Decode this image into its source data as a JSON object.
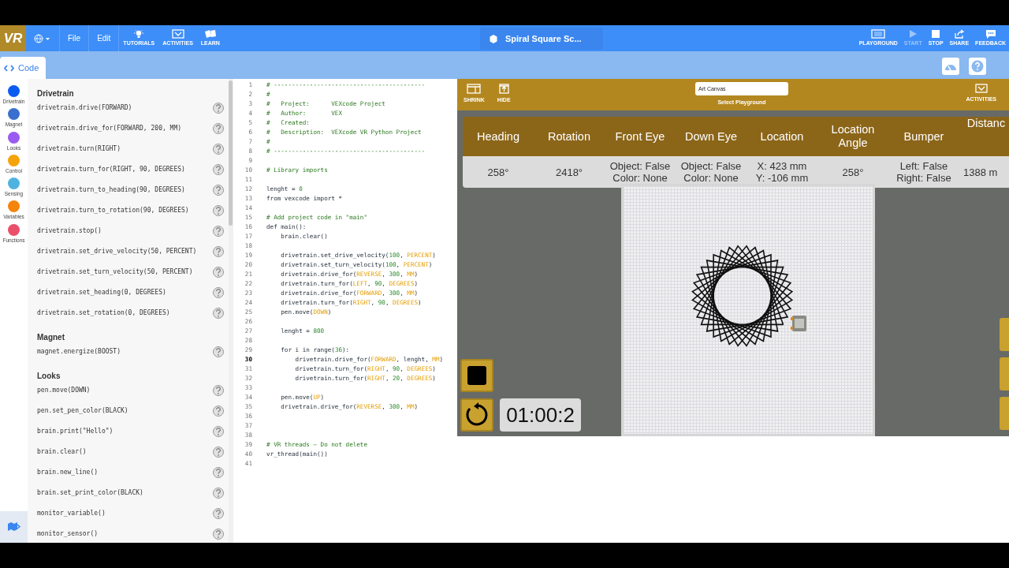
{
  "app_bar": {
    "logo": "VR",
    "menus": [
      {
        "label": "File"
      },
      {
        "label": "Edit"
      }
    ],
    "tools": [
      {
        "label": "TUTORIALS",
        "kind": "bulb"
      },
      {
        "label": "ACTIVITIES",
        "kind": "check"
      },
      {
        "label": "LEARN",
        "kind": "book"
      }
    ],
    "project_title": "Spiral Square Sc...",
    "actions": [
      {
        "label": "PLAYGROUND",
        "kind": "playground",
        "disabled": false
      },
      {
        "label": "START",
        "kind": "play",
        "disabled": true
      },
      {
        "label": "STOP",
        "kind": "stop",
        "disabled": false
      },
      {
        "label": "SHARE",
        "kind": "share",
        "disabled": false
      },
      {
        "label": "FEEDBACK",
        "kind": "feedback",
        "disabled": false
      }
    ]
  },
  "tabs": [
    {
      "label": "Code",
      "selected": true
    }
  ],
  "categories": [
    {
      "label": "Drivetrain",
      "color": "#0b5cf0"
    },
    {
      "label": "Magnet",
      "color": "#3a6fd0"
    },
    {
      "label": "Looks",
      "color": "#9a5cf0"
    },
    {
      "label": "Control",
      "color": "#f5a30a"
    },
    {
      "label": "Sensing",
      "color": "#4fb3e0"
    },
    {
      "label": "Variables",
      "color": "#f5840c"
    },
    {
      "label": "Functions",
      "color": "#ea4f6c"
    }
  ],
  "palette": [
    {
      "title": "Drivetrain",
      "blocks": [
        "drivetrain.drive(FORWARD)",
        "drivetrain.drive_for(FORWARD, 200, MM)",
        "drivetrain.turn(RIGHT)",
        "drivetrain.turn_for(RIGHT, 90, DEGREES)",
        "drivetrain.turn_to_heading(90, DEGREES)",
        "drivetrain.turn_to_rotation(90, DEGREES)",
        "drivetrain.stop()",
        "drivetrain.set_drive_velocity(50, PERCENT)",
        "drivetrain.set_turn_velocity(50, PERCENT)",
        "drivetrain.set_heading(0, DEGREES)",
        "drivetrain.set_rotation(0, DEGREES)"
      ]
    },
    {
      "title": "Magnet",
      "blocks": [
        "magnet.energize(BOOST)"
      ]
    },
    {
      "title": "Looks",
      "blocks": [
        "pen.move(DOWN)",
        "pen.set_pen_color(BLACK)",
        "brain.print(\"Hello\")",
        "brain.clear()",
        "brain.new_line()",
        "brain.set_print_color(BLACK)",
        "monitor_variable()",
        "monitor_sensor()"
      ]
    }
  ],
  "editor": {
    "lines": [
      {
        "n": "1",
        "current": false,
        "segs": [
          {
            "text": "# ------------------------------------------",
            "kind": "comment"
          }
        ]
      },
      {
        "n": "2",
        "current": false,
        "segs": [
          {
            "text": "#",
            "kind": "comment"
          }
        ]
      },
      {
        "n": "3",
        "current": false,
        "segs": [
          {
            "text": "#   Project:      VEXcode Project",
            "kind": "comment"
          }
        ]
      },
      {
        "n": "4",
        "current": false,
        "segs": [
          {
            "text": "#   Author:       VEX",
            "kind": "comment"
          }
        ]
      },
      {
        "n": "5",
        "current": false,
        "segs": [
          {
            "text": "#   Created:",
            "kind": "comment"
          }
        ]
      },
      {
        "n": "6",
        "current": false,
        "segs": [
          {
            "text": "#   Description:  VEXcode VR Python Project",
            "kind": "comment"
          }
        ]
      },
      {
        "n": "7",
        "current": false,
        "segs": [
          {
            "text": "#",
            "kind": "comment"
          }
        ]
      },
      {
        "n": "8",
        "current": false,
        "segs": [
          {
            "text": "# ------------------------------------------",
            "kind": "comment"
          }
        ]
      },
      {
        "n": "9",
        "current": false
      },
      {
        "n": "10",
        "current": false,
        "segs": [
          {
            "text": "# Library imports",
            "kind": "comment"
          }
        ]
      },
      {
        "n": "11",
        "current": false
      },
      {
        "n": "12",
        "current": false,
        "segs": [
          {
            "text": "lenght = ",
            "kind": "plain"
          },
          {
            "text": "0",
            "kind": "number"
          }
        ]
      },
      {
        "n": "13",
        "current": false,
        "segs": [
          {
            "text": "from vexcode import *",
            "kind": "plain"
          }
        ]
      },
      {
        "n": "14",
        "current": false
      },
      {
        "n": "15",
        "current": false,
        "segs": [
          {
            "text": "# Add project code in \"main\"",
            "kind": "comment"
          }
        ]
      },
      {
        "n": "16",
        "current": false,
        "segs": [
          {
            "text": "def main():",
            "kind": "plain"
          }
        ]
      },
      {
        "n": "17",
        "current": false,
        "segs": [
          {
            "text": "    brain.clear()",
            "kind": "plain"
          }
        ]
      },
      {
        "n": "18",
        "current": false
      },
      {
        "n": "19",
        "current": false,
        "segs": [
          {
            "text": "    drivetrain.set_drive_velocity(",
            "kind": "plain"
          },
          {
            "text": "100",
            "kind": "number"
          },
          {
            "text": ", ",
            "kind": "plain"
          },
          {
            "text": "PERCENT",
            "kind": "constant"
          },
          {
            "text": ")",
            "kind": "plain"
          }
        ]
      },
      {
        "n": "20",
        "current": false,
        "segs": [
          {
            "text": "    drivetrain.set_turn_velocity(",
            "kind": "plain"
          },
          {
            "text": "100",
            "kind": "number"
          },
          {
            "text": ", ",
            "kind": "plain"
          },
          {
            "text": "PERCENT",
            "kind": "constant"
          },
          {
            "text": ")",
            "kind": "plain"
          }
        ]
      },
      {
        "n": "21",
        "current": false,
        "segs": [
          {
            "text": "    drivetrain.drive_for(",
            "kind": "plain"
          },
          {
            "text": "REVERSE",
            "kind": "constant"
          },
          {
            "text": ", ",
            "kind": "plain"
          },
          {
            "text": "300",
            "kind": "number"
          },
          {
            "text": ", ",
            "kind": "plain"
          },
          {
            "text": "MM",
            "kind": "constant"
          },
          {
            "text": ")",
            "kind": "plain"
          }
        ]
      },
      {
        "n": "22",
        "current": false,
        "segs": [
          {
            "text": "    drivetrain.turn_for(",
            "kind": "plain"
          },
          {
            "text": "LEFT",
            "kind": "constant"
          },
          {
            "text": ", ",
            "kind": "plain"
          },
          {
            "text": "90",
            "kind": "number"
          },
          {
            "text": ", ",
            "kind": "plain"
          },
          {
            "text": "DEGREES",
            "kind": "constant"
          },
          {
            "text": ")",
            "kind": "plain"
          }
        ]
      },
      {
        "n": "23",
        "current": false,
        "segs": [
          {
            "text": "    drivetrain.drive_for(",
            "kind": "plain"
          },
          {
            "text": "FORWARD",
            "kind": "constant"
          },
          {
            "text": ", ",
            "kind": "plain"
          },
          {
            "text": "300",
            "kind": "number"
          },
          {
            "text": ", ",
            "kind": "plain"
          },
          {
            "text": "MM",
            "kind": "constant"
          },
          {
            "text": ")",
            "kind": "plain"
          }
        ]
      },
      {
        "n": "24",
        "current": false,
        "segs": [
          {
            "text": "    drivetrain.turn_for(",
            "kind": "plain"
          },
          {
            "text": "RIGHT",
            "kind": "constant"
          },
          {
            "text": ", ",
            "kind": "plain"
          },
          {
            "text": "90",
            "kind": "number"
          },
          {
            "text": ", ",
            "kind": "plain"
          },
          {
            "text": "DEGREES",
            "kind": "constant"
          },
          {
            "text": ")",
            "kind": "plain"
          }
        ]
      },
      {
        "n": "25",
        "current": false,
        "segs": [
          {
            "text": "    pen.move(",
            "kind": "plain"
          },
          {
            "text": "DOWN",
            "kind": "constant"
          },
          {
            "text": ")",
            "kind": "plain"
          }
        ]
      },
      {
        "n": "26",
        "current": false
      },
      {
        "n": "27",
        "current": false,
        "segs": [
          {
            "text": "    lenght = ",
            "kind": "plain"
          },
          {
            "text": "800",
            "kind": "number"
          }
        ]
      },
      {
        "n": "28",
        "current": false
      },
      {
        "n": "29",
        "current": false,
        "segs": [
          {
            "text": "    for i in range(",
            "kind": "plain"
          },
          {
            "text": "36",
            "kind": "number"
          },
          {
            "text": "):",
            "kind": "plain"
          }
        ]
      },
      {
        "n": "30",
        "current": true,
        "segs": [
          {
            "text": "        drivetrain.drive_for(",
            "kind": "plain"
          },
          {
            "text": "FORWARD",
            "kind": "constant"
          },
          {
            "text": ", lenght, ",
            "kind": "plain"
          },
          {
            "text": "MM",
            "kind": "constant"
          },
          {
            "text": ")",
            "kind": "plain"
          }
        ]
      },
      {
        "n": "31",
        "current": false,
        "segs": [
          {
            "text": "        drivetrain.turn_for(",
            "kind": "plain"
          },
          {
            "text": "RIGHT",
            "kind": "constant"
          },
          {
            "text": ", ",
            "kind": "plain"
          },
          {
            "text": "90",
            "kind": "number"
          },
          {
            "text": ", ",
            "kind": "plain"
          },
          {
            "text": "DEGREES",
            "kind": "constant"
          },
          {
            "text": ")",
            "kind": "plain"
          }
        ]
      },
      {
        "n": "32",
        "current": false,
        "segs": [
          {
            "text": "        drivetrain.turn_for(",
            "kind": "plain"
          },
          {
            "text": "RIGHT",
            "kind": "constant"
          },
          {
            "text": ", ",
            "kind": "plain"
          },
          {
            "text": "20",
            "kind": "number"
          },
          {
            "text": ", ",
            "kind": "plain"
          },
          {
            "text": "DEGREES",
            "kind": "constant"
          },
          {
            "text": ")",
            "kind": "plain"
          }
        ]
      },
      {
        "n": "33",
        "current": false
      },
      {
        "n": "34",
        "current": false,
        "segs": [
          {
            "text": "    pen.move(",
            "kind": "plain"
          },
          {
            "text": "UP",
            "kind": "constant"
          },
          {
            "text": ")",
            "kind": "plain"
          }
        ]
      },
      {
        "n": "35",
        "current": false,
        "segs": [
          {
            "text": "    drivetrain.drive_for(",
            "kind": "plain"
          },
          {
            "text": "REVERSE",
            "kind": "constant"
          },
          {
            "text": ", ",
            "kind": "plain"
          },
          {
            "text": "300",
            "kind": "number"
          },
          {
            "text": ", ",
            "kind": "plain"
          },
          {
            "text": "MM",
            "kind": "constant"
          },
          {
            "text": ")",
            "kind": "plain"
          }
        ]
      },
      {
        "n": "36",
        "current": false
      },
      {
        "n": "37",
        "current": false
      },
      {
        "n": "38",
        "current": false
      },
      {
        "n": "39",
        "current": false,
        "segs": [
          {
            "text": "# VR threads — Do not delete",
            "kind": "comment"
          }
        ]
      },
      {
        "n": "40",
        "current": false,
        "segs": [
          {
            "text": "vr_thread(main())",
            "kind": "plain"
          }
        ]
      },
      {
        "n": "41",
        "current": false
      }
    ]
  },
  "playground": {
    "controls": [
      {
        "label": "SHRINK",
        "kind": "shrink"
      },
      {
        "label": "HIDE",
        "kind": "hide"
      }
    ],
    "select": {
      "value": "Art Canvas",
      "label": "Select Playground"
    },
    "activities": "ACTIVITIES",
    "sensors": [
      {
        "header": "Heading",
        "value": [
          "258°"
        ]
      },
      {
        "header": "Rotation",
        "value": [
          "2418°"
        ]
      },
      {
        "header": "Front Eye",
        "value": [
          "Object: False",
          "Color: None"
        ]
      },
      {
        "header": "Down Eye",
        "value": [
          "Object: False",
          "Color: None"
        ]
      },
      {
        "header": "Location",
        "value": [
          "X: 423 mm",
          "Y: -106 mm"
        ]
      },
      {
        "header": "Location Angle",
        "value": [
          "258°"
        ]
      },
      {
        "header": "Bumper",
        "value": [
          "Left: False",
          "Right: False"
        ]
      },
      {
        "header": "Distanc",
        "value": [
          "1388 m"
        ]
      }
    ],
    "timer": "01:00:2"
  }
}
